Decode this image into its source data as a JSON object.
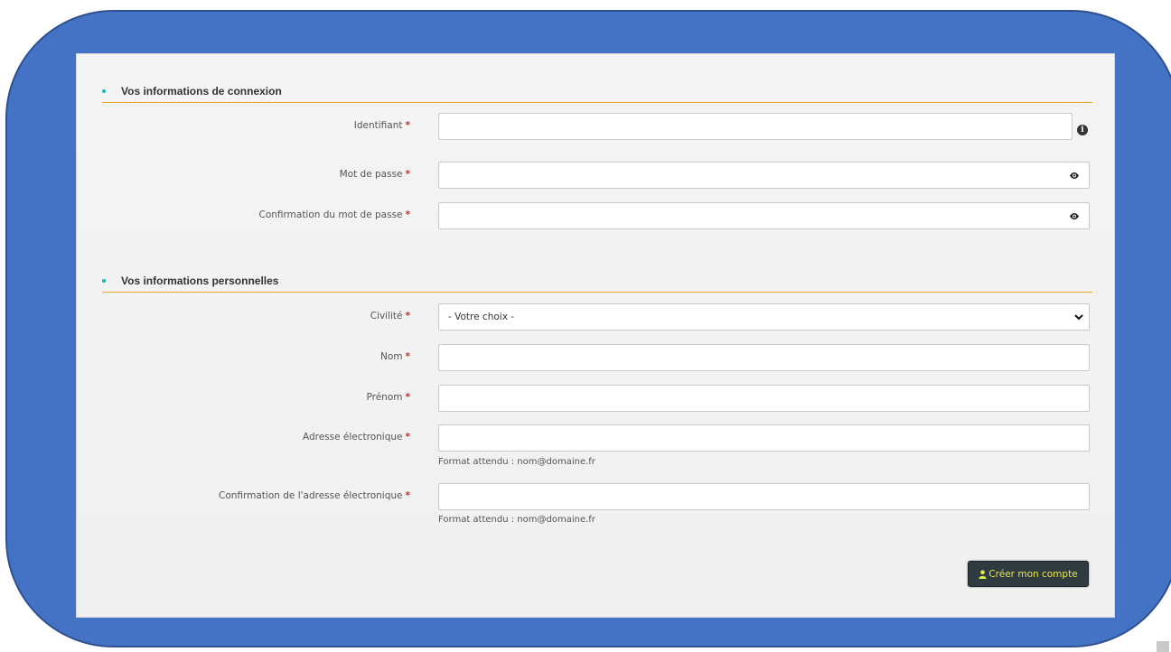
{
  "sections": {
    "login": {
      "title": "Vos informations de connexion",
      "fields": {
        "identifier": {
          "label": "Identifiant",
          "value": ""
        },
        "password": {
          "label": "Mot de passe",
          "value": ""
        },
        "password_confirm": {
          "label": "Confirmation du mot de passe",
          "value": ""
        }
      }
    },
    "personal": {
      "title": "Vos informations personnelles",
      "fields": {
        "civility": {
          "label": "Civilité",
          "selected": "- Votre choix -"
        },
        "last_name": {
          "label": "Nom",
          "value": ""
        },
        "first_name": {
          "label": "Prénom",
          "value": ""
        },
        "email": {
          "label": "Adresse électronique",
          "value": "",
          "hint": "Format attendu : nom@domaine.fr"
        },
        "email_confirm": {
          "label": "Confirmation de l'adresse électronique",
          "value": "",
          "hint": "Format attendu : nom@domaine.fr"
        }
      }
    }
  },
  "required_marker": "*",
  "submit": {
    "label": "Créer mon compte",
    "icon": "user-icon"
  },
  "icons": {
    "info": "info-icon",
    "eye": "eye-icon",
    "select": "chevron-down-icon"
  },
  "colors": {
    "frame": "#4472c4",
    "section_rule": "#e8a52a",
    "bullet": "#19b4b4",
    "required": "#d9251d",
    "button_bg": "#2f3a41",
    "button_text": "#e8e84a"
  }
}
